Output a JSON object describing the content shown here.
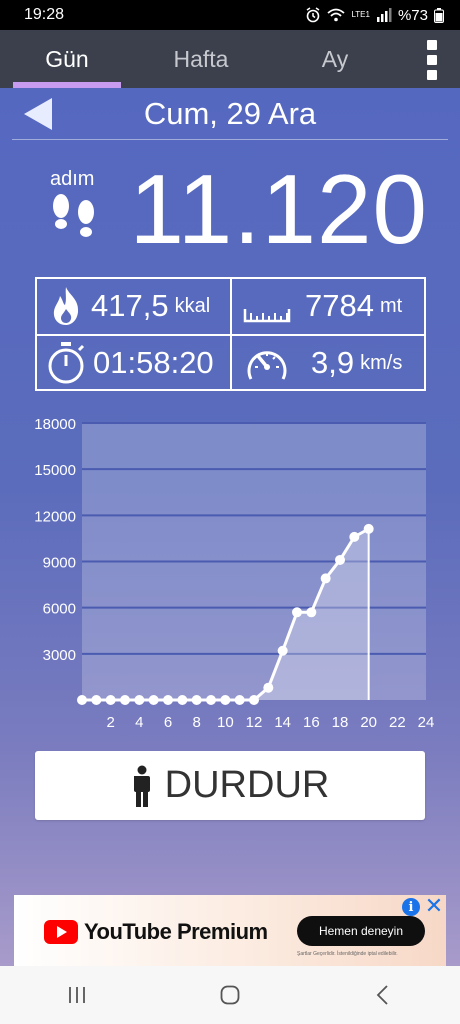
{
  "status_bar": {
    "time": "19:28",
    "network": "LTE1",
    "battery": "%73"
  },
  "tabs": [
    {
      "label": "Gün",
      "active": true
    },
    {
      "label": "Hafta",
      "active": false
    },
    {
      "label": "Ay",
      "active": false
    }
  ],
  "date_header": {
    "date": "Cum, 29 Ara"
  },
  "steps": {
    "label": "adım",
    "value": "11.120"
  },
  "stats": {
    "calories": {
      "value": "417,5",
      "unit": "kkal",
      "icon": "fire-icon"
    },
    "distance": {
      "value": "7784",
      "unit": "mt",
      "icon": "ruler-icon"
    },
    "duration": {
      "value": "01:58:20",
      "icon": "stopwatch-icon"
    },
    "speed": {
      "value": "3,9",
      "unit": "km/s",
      "icon": "speedometer-icon"
    }
  },
  "chart_data": {
    "type": "line",
    "x": [
      0,
      1,
      2,
      3,
      4,
      5,
      6,
      7,
      8,
      9,
      10,
      11,
      12,
      13,
      14,
      15,
      16,
      17,
      18,
      19,
      20
    ],
    "values": [
      0,
      0,
      0,
      0,
      0,
      0,
      0,
      0,
      0,
      0,
      0,
      0,
      0,
      800,
      3200,
      5700,
      5700,
      7900,
      9100,
      10600,
      11120
    ],
    "x_ticks": [
      2,
      4,
      6,
      8,
      10,
      12,
      14,
      16,
      18,
      20,
      22,
      24
    ],
    "y_ticks": [
      3000,
      6000,
      9000,
      12000,
      15000,
      18000
    ],
    "xlim": [
      0,
      24
    ],
    "ylim": [
      0,
      18000
    ],
    "grid": true,
    "xlabel": "",
    "ylabel": ""
  },
  "stop_button": {
    "label": "DURDUR",
    "icon": "person-icon"
  },
  "ad": {
    "brand": "YouTube Premium",
    "cta": "Hemen deneyin",
    "fine_print": "Şartlar Geçerlidir. İstenildiğinde iptal edilebilir."
  },
  "colors": {
    "accent": "#c79bf0",
    "tab_bg": "#3b404c",
    "main_top": "#5568c0",
    "main_bottom": "#a89bca"
  }
}
